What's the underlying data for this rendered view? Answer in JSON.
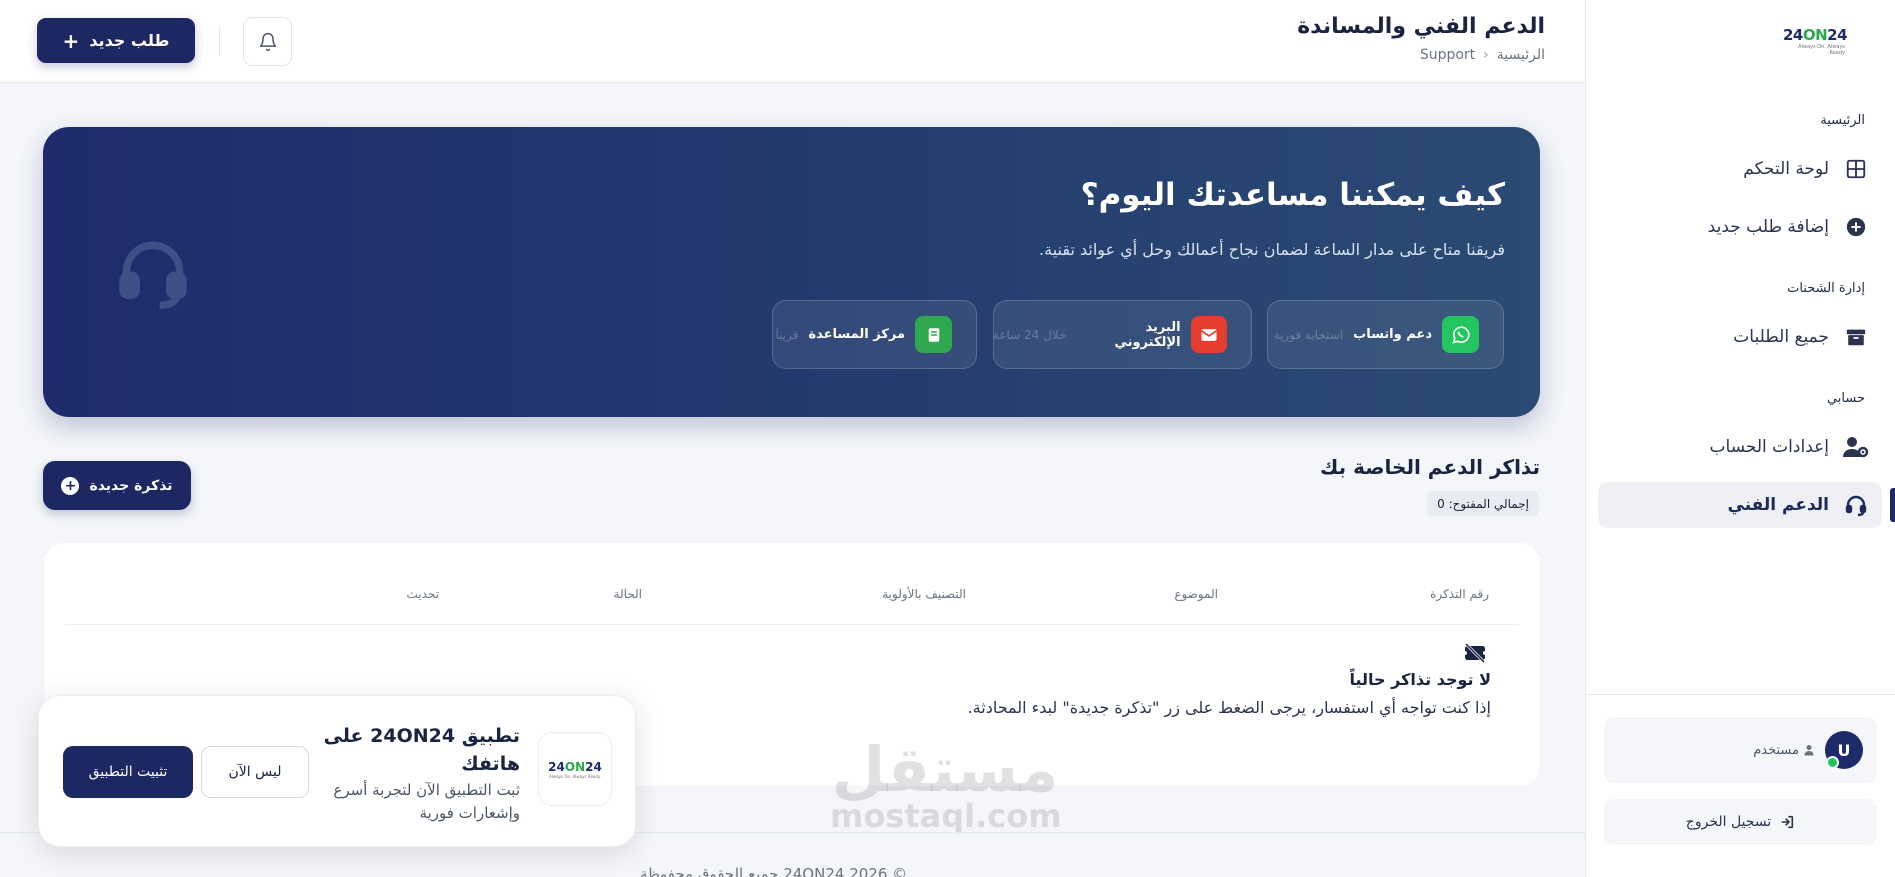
{
  "sidebar": {
    "logo_text": "24ON24",
    "logo_tagline": "Always On. Always Ready.",
    "sections": [
      {
        "title": "الرئيسية",
        "items": [
          {
            "label": "لوحة التحكم",
            "icon": "grid-icon"
          },
          {
            "label": "إضافة طلب جديد",
            "icon": "plus-circle-icon"
          }
        ]
      },
      {
        "title": "إدارة الشحنات",
        "items": [
          {
            "label": "جميع الطلبات",
            "icon": "box-icon"
          }
        ]
      },
      {
        "title": "حسابي",
        "items": [
          {
            "label": "إعدادات الحساب",
            "icon": "user-gear-icon"
          },
          {
            "label": "الدعم الفني",
            "icon": "headset-icon"
          }
        ]
      }
    ],
    "user": {
      "avatar_letter": "U",
      "name": "مستخدم"
    },
    "logout_label": "تسجيل الخروج"
  },
  "header": {
    "title": "الدعم الفني والمساندة",
    "breadcrumb_home": "الرئيسية",
    "breadcrumb_current": "Support",
    "new_order_label": "طلب جديد"
  },
  "hero": {
    "title": "كيف يمكننا مساعدتك اليوم؟",
    "subtitle": "فريقنا متاح على مدار الساعة لضمان نجاح أعمالك وحل أي عوائد تقنية.",
    "channels": [
      {
        "label": "دعم واتساب",
        "sub": "استجابة فورية",
        "color": "#22c55e",
        "icon": "whatsapp-icon"
      },
      {
        "label": "البريد الإلكتروني",
        "sub": "خلال 24 ساعة",
        "color": "#e53e2f",
        "icon": "mail-icon"
      },
      {
        "label": "مركز المساعدة",
        "sub": "قريباً",
        "color": "#2fa84f",
        "icon": "book-icon"
      }
    ]
  },
  "tickets": {
    "title": "تذاكر الدعم الخاصة بك",
    "badge": "إجمالي المفتوح: 0",
    "new_ticket_label": "تذكرة جديدة",
    "columns": [
      "رقم التذكرة",
      "الموضوع",
      "التصنيف بالأولوية",
      "الحالة",
      "تحديث"
    ],
    "empty_title": "لا توجد تذاكر حالياً",
    "empty_text": "إذا كنت تواجه أي استفسار، يرجى الضغط على زر \"تذكرة جديدة\" لبدء المحادثة."
  },
  "footer": {
    "text": "© 2026 24ON24 جميع الحقوق محفوظة"
  },
  "install_popup": {
    "title": "تطبيق 24ON24 على هاتفك",
    "description": "ثبت التطبيق الآن لتجربة أسرع وإشعارات فورية",
    "later_label": "ليس الآن",
    "install_label": "تثبيت التطبيق"
  },
  "watermark": {
    "line1": "مستقل",
    "line2": "mostaql.com"
  }
}
